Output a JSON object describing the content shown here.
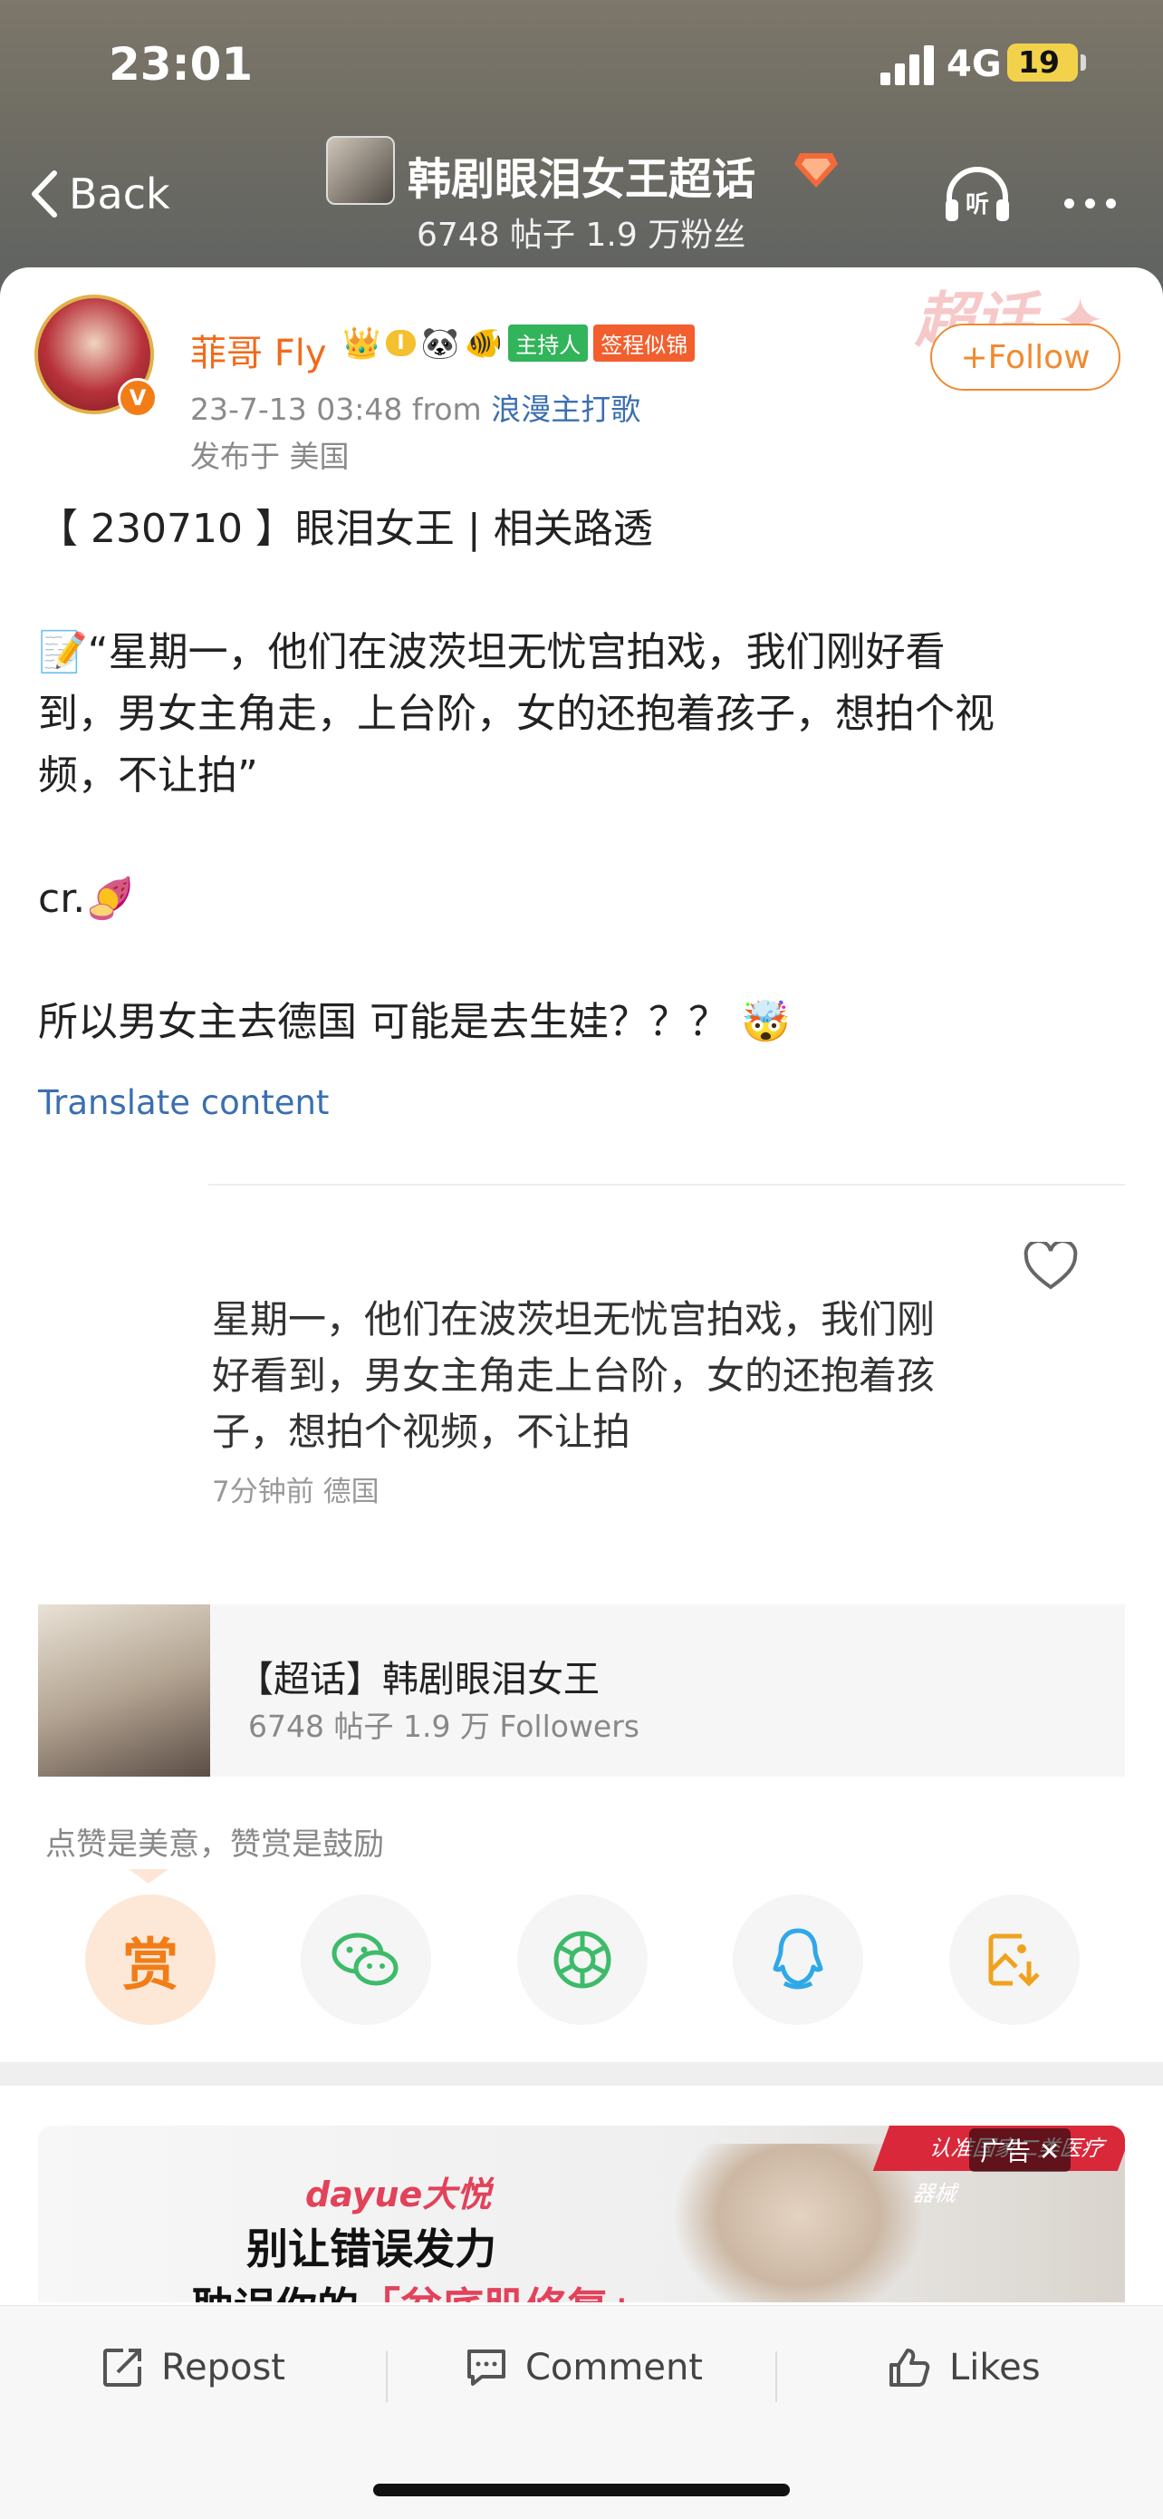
{
  "status_bar": {
    "time": "23:01",
    "network": "4G",
    "battery": "19"
  },
  "nav": {
    "back_label": "Back",
    "group_title": "韩剧眼泪女王超话",
    "group_stats": "6748 帖子 1.9 万粉丝"
  },
  "post": {
    "author": "菲哥 Fly",
    "badges": {
      "level": "I",
      "host": "主持人",
      "sign": "签程似锦"
    },
    "follow_label": "+Follow",
    "timestamp": "23-7-13 03:48",
    "from_word": "from",
    "source": "浪漫主打歌",
    "location": "发布于 美国",
    "body": {
      "line1": "【 230710 】眼泪女王 | 相关路透",
      "quote_l1": "📝“星期一，他们在波茨坦无忧宫拍戏，我们刚好看",
      "quote_l2": "到，男女主角走，上台阶，女的还抱着孩子，想拍个视",
      "quote_l3": "频，不让拍”",
      "credit": " cr.🍠",
      "closing": "所以男女主去德国 可能是去生娃？？？ 🤯"
    },
    "translate_label": "Translate content"
  },
  "quoted_comment": {
    "text": "星期一，他们在波茨坦无忧宫拍戏，我们刚好看到，男女主角走上台阶，女的还抱着孩子，想拍个视频，不让拍",
    "meta": "7分钟前  德国"
  },
  "topic": {
    "title": "【超话】韩剧眼泪女王",
    "stats": "6748 帖子 1.9 万 Followers"
  },
  "reward": {
    "hint": "点赞是美意，赞赏是鼓励",
    "reward_char": "赏"
  },
  "share_icons": [
    "reward-icon",
    "wechat-icon",
    "moments-icon",
    "qq-icon",
    "save-image-icon"
  ],
  "ad": {
    "brand": "dayue大悦",
    "line1": "别让错误发力",
    "line2_prefix": "耽误你的",
    "line2_highlight": "「盆底肌修复」",
    "banner": "认准国家二类医疗器械",
    "label": "广告 ✕"
  },
  "actions": {
    "repost": "Repost",
    "comment": "Comment",
    "likes": "Likes"
  },
  "colors": {
    "accent": "#f27d17",
    "link": "#3b6fb0",
    "follow": "#f08a30"
  }
}
